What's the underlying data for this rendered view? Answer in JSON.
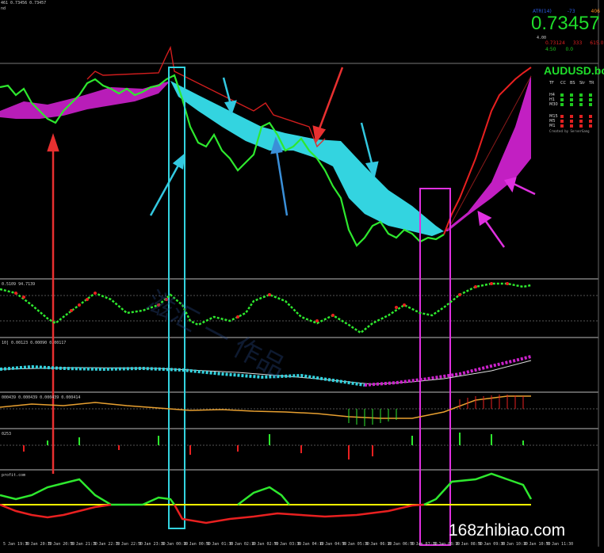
{
  "header": {
    "line1": "461 0.73456 0.73457",
    "line2": "nd",
    "price_change": "4.00"
  },
  "panel": {
    "blue_label": "ATR(14)",
    "top_a": "-73",
    "top_b": "406",
    "bid": "0.73457",
    "row2": [
      "0.73124",
      "333",
      "615.0"
    ],
    "row3": [
      "4:50",
      "0.0"
    ],
    "symbol": "AUDUSD.bo",
    "columns": [
      "TF",
      "CC",
      "BS",
      "Str",
      "TR"
    ],
    "timeframes_top": [
      "H4",
      "H1",
      "M30"
    ],
    "timeframes_bottom": [
      "M15",
      "M5",
      "M1"
    ],
    "credit": "Created by ServerGang",
    "colors": {
      "green": "#1ec81e",
      "red": "#e02020"
    }
  },
  "subwindows": [
    {
      "label": "0.5109 94.7139"
    },
    {
      "label": "10] 0.00123 0.00090 0.00117"
    },
    {
      "label": "000439 0.000439 0.000439 0.000414"
    },
    {
      "label": "0253"
    },
    {
      "label": "profit.com"
    }
  ],
  "time_axis": [
    "5 Jan 19:30",
    "5 Jan 20:10",
    "5 Jan 20:50",
    "5 Jan 21:30",
    "5 Jan 22:10",
    "5 Jan 22:50",
    "5 Jan 23:30",
    "6 Jan 00:10",
    "6 Jan 00:50",
    "6 Jan 01:30",
    "6 Jan 02:10",
    "6 Jan 02:50",
    "6 Jan 03:30",
    "6 Jan 04:10",
    "6 Jan 04:50",
    "6 Jan 05:30",
    "6 Jan 06:10",
    "6 Jan 06:50",
    "6 Jan 07:30",
    "6 Jan 08:10",
    "6 Jan 08:50",
    "6 Jan 09:30",
    "6 Jan 10:10",
    "6 Jan 10:50",
    "6 Jan 11:30"
  ],
  "watermark": "168zhibiao.com",
  "background_watermark": "滋汇 一 作品",
  "colors": {
    "cyan": "#33d4e0",
    "magenta": "#cc22cc",
    "yellow": "#ffff00",
    "arrow_red": "#e83030"
  }
}
